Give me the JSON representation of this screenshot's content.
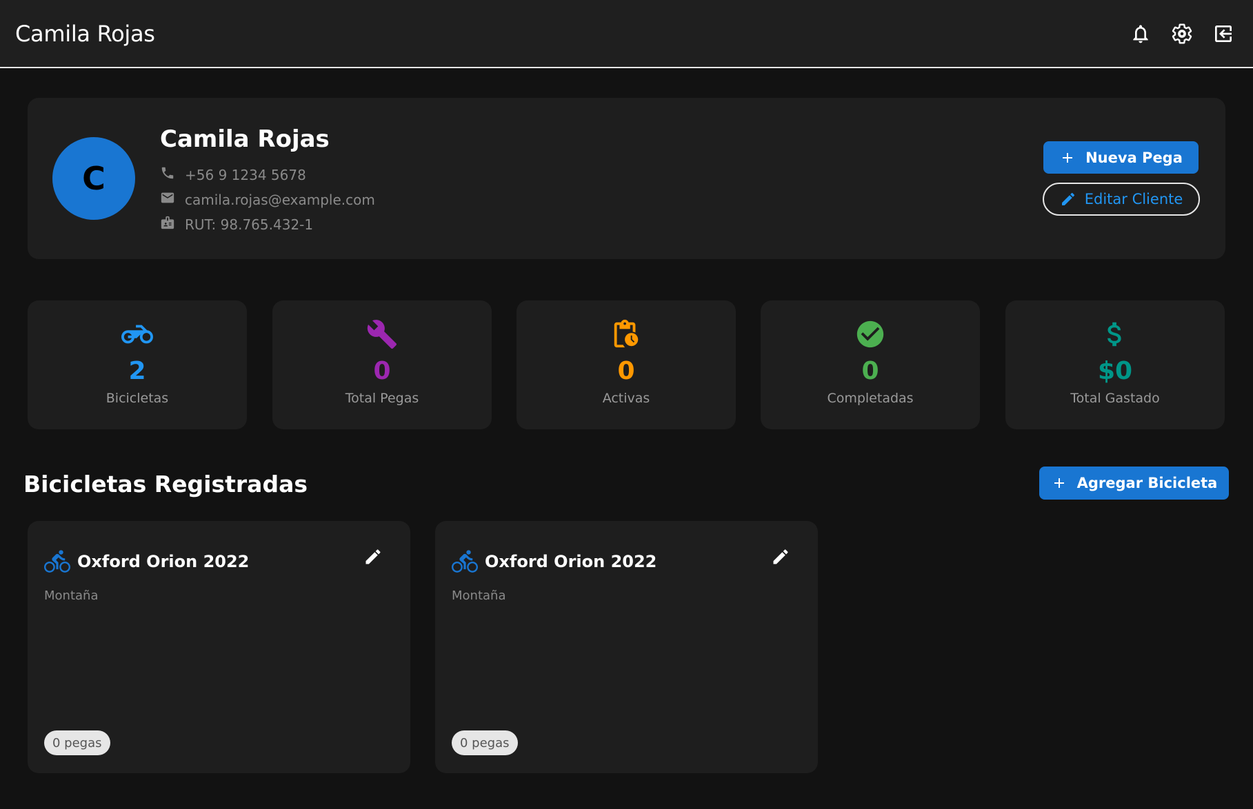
{
  "header": {
    "title": "Camila Rojas",
    "icons": [
      "bell-icon",
      "gear-icon",
      "logout-icon"
    ]
  },
  "profile": {
    "avatar_letter": "C",
    "name": "Camila Rojas",
    "phone": "+56 9 1234 5678",
    "email": "camila.rojas@example.com",
    "rut": "RUT: 98.765.432-1",
    "new_job_label": "Nueva Pega",
    "edit_client_label": "Editar Cliente"
  },
  "stats": [
    {
      "icon": "motorbike-icon",
      "value": "2",
      "label": "Bicicletas",
      "color": "#2196f3"
    },
    {
      "icon": "wrench-icon",
      "value": "0",
      "label": "Total Pegas",
      "color": "#9c27b0"
    },
    {
      "icon": "clipboard-clock-icon",
      "value": "0",
      "label": "Activas",
      "color": "#ff9800"
    },
    {
      "icon": "check-circle-icon",
      "value": "0",
      "label": "Completadas",
      "color": "#4caf50"
    },
    {
      "icon": "dollar-icon",
      "value": "$0",
      "label": "Total Gastado",
      "color": "#009688"
    }
  ],
  "bikes_section": {
    "title": "Bicicletas Registradas",
    "add_label": "Agregar Bicicleta"
  },
  "bikes": [
    {
      "name": "Oxford Orion 2022",
      "type": "Montaña",
      "jobs": "0 pegas"
    },
    {
      "name": "Oxford Orion 2022",
      "type": "Montaña",
      "jobs": "0 pegas"
    }
  ],
  "colors": {
    "accent": "#1976d2",
    "background": "#121212",
    "card": "#1e1e1e"
  }
}
